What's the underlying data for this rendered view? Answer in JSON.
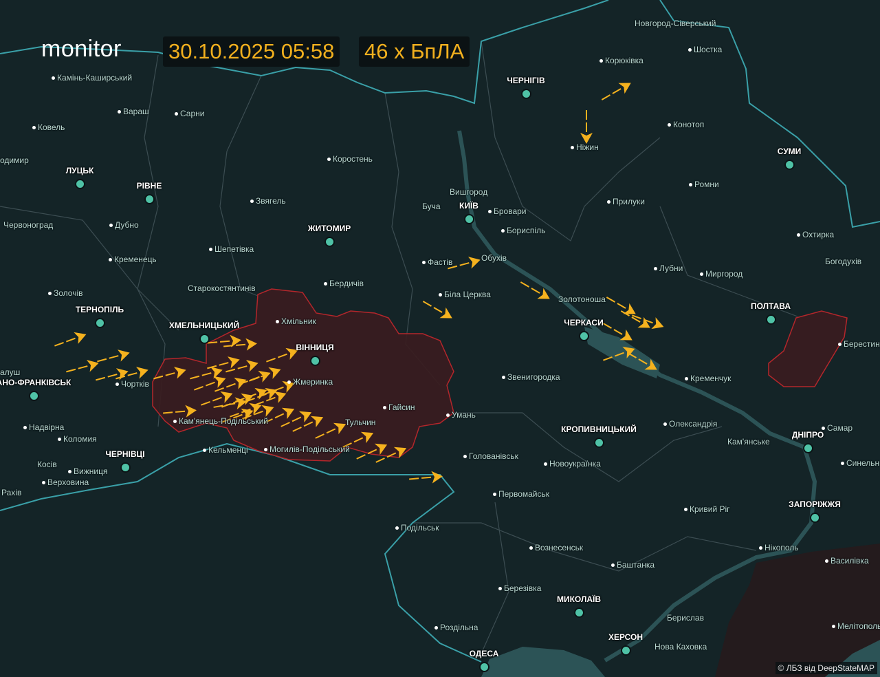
{
  "header": {
    "logo": "monitor",
    "datetime": "30.10.2025 05:58",
    "drone_count": "46 x БпЛА"
  },
  "colors": {
    "land": "#142427",
    "border": "#3aa0a8",
    "water": "#2c5356",
    "alert_region": "#3a1c1f",
    "alert_border": "#b3262b",
    "drone": "#f5b21e",
    "occupied": "#241b1d",
    "oblast_center": "#4fc2a6"
  },
  "oblast_centers": [
    "ЛУЦЬК",
    "РІВНЕ",
    "ЖИТОМИР",
    "ТЕРНОПІЛЬ",
    "ХМЕЛЬНИЦЬКИЙ",
    "ВІННИЦЯ",
    "АНО-ФРАНКІВСЬК",
    "ЧЕРНІВЦІ",
    "КИЇВ",
    "ЧЕРНІГІВ",
    "СУМИ",
    "ПОЛТАВА",
    "ЧЕРКАСИ",
    "КРОПИВНИЦЬКИЙ",
    "ДНІПРО",
    "ЗАПОРІЖЖЯ",
    "МИКОЛАЇВ",
    "ХЕРСОН",
    "ОДЕСА"
  ],
  "towns": [
    "Камінь-Каширський",
    "Вараш",
    "Сарни",
    "Ковель",
    "одимир",
    "Коростень",
    "Дубно",
    "Звягель",
    "Червоноград",
    "Кременець",
    "Шепетівка",
    "Золочів",
    "Старокостянтинів",
    "Бердичів",
    "Хмільник",
    "Жмеринка",
    "Чортків",
    "алуш",
    "Кам'янець-Подільський",
    "Кельменці",
    "Могилів-Подільський",
    "Гайсин",
    "Тульчин",
    "Умань",
    "Надвірна",
    "Коломия",
    "Косів",
    "Вижниця",
    "Верховина",
    "Рахів",
    "Фастів",
    "Буча",
    "Вишгород",
    "Бровари",
    "Бориспіль",
    "Обухів",
    "Біла Церква",
    "Золотоноша",
    "Звенигородка",
    "Кременчук",
    "Олександрія",
    "Голованівськ",
    "Новоукраїнка",
    "Первомайськ",
    "Подільськ",
    "Вознесенськ",
    "Баштанка",
    "Березівка",
    "Роздільна",
    "Берислав",
    "Нова Каховка",
    "Кривий Ріг",
    "Нікополь",
    "Кам'янське",
    "Самар",
    "Синельн",
    "Василівка",
    "Мелітополь",
    "Берестин",
    "Богодухів",
    "Охтирка",
    "Ромни",
    "Прилуки",
    "Лубни",
    "Миргород",
    "Ніжин",
    "Корюківка",
    "Шостка",
    "Новгород-Сіверський",
    "Конотоп"
  ],
  "legend": {
    "drone_icon": "shahed-drone-icon"
  },
  "attribution": "© ЛБЗ від DeepStateMAP"
}
